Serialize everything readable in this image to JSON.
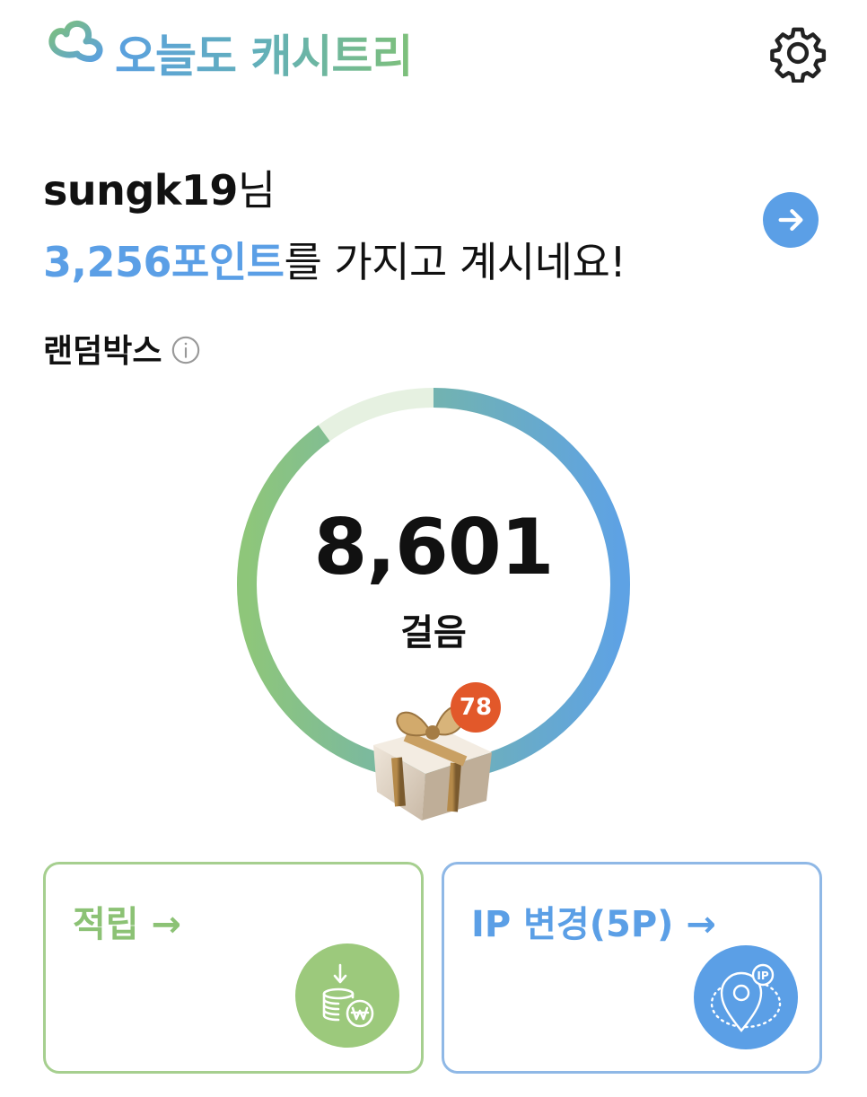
{
  "app": {
    "logo_text": "오늘도 캐시트리"
  },
  "user": {
    "name": "sungk19",
    "name_suffix": "님",
    "points": "3,256포인트",
    "points_suffix": "를 가지고 계시네요!"
  },
  "random_box": {
    "title": "랜덤박스",
    "steps": "8,601",
    "steps_unit": "걸음",
    "badge_count": "78",
    "progress": 0.9
  },
  "cards": {
    "earn_label": "적립 →",
    "ip_label": "IP 변경(5P) →"
  },
  "icons": {
    "settings": "gear-icon",
    "go": "arrow-right-icon",
    "info": "info-icon",
    "gift": "gift-box-icon",
    "earn": "coins-won-icon",
    "ip": "location-ip-icon"
  },
  "colors": {
    "accent_blue": "#5b9fe6",
    "accent_green": "#8cc275",
    "badge": "#e2582a"
  }
}
